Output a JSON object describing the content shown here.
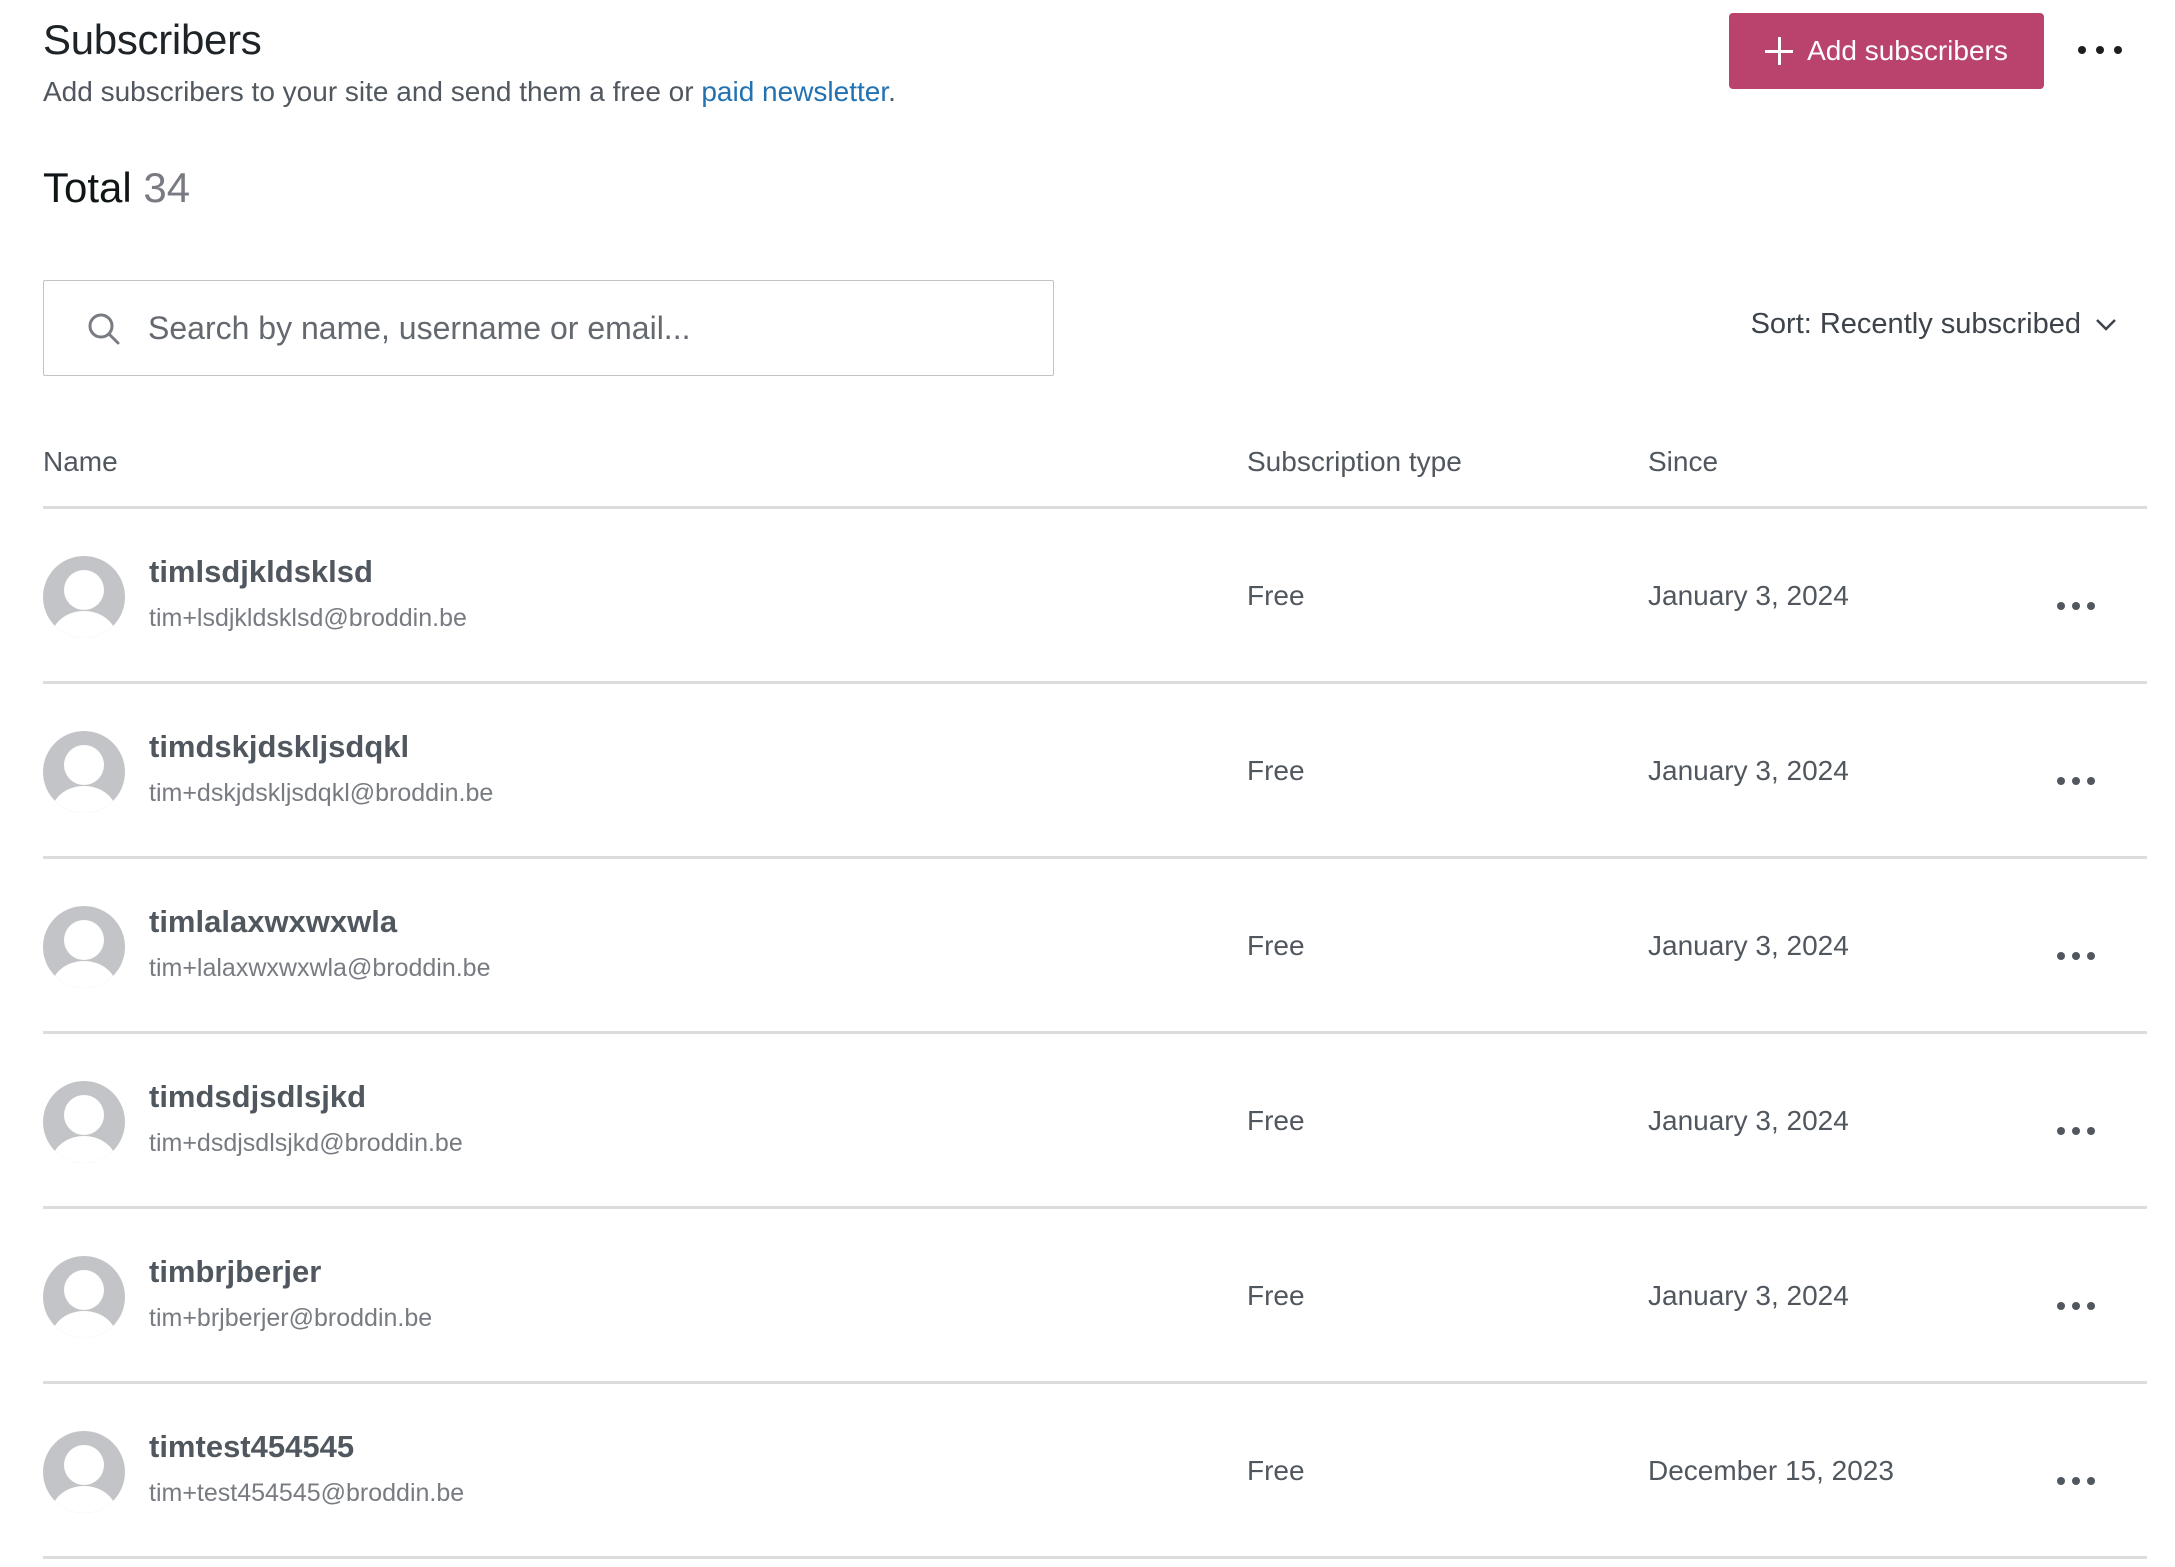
{
  "header": {
    "title": "Subscribers",
    "subtitle_prefix": "Add subscribers to your site and send them a free or ",
    "subtitle_link": "paid newsletter",
    "subtitle_suffix": ".",
    "add_button_label": "Add subscribers",
    "add_button_icon": "plus-icon",
    "more_menu_icon": "ellipsis-icon"
  },
  "total": {
    "label": "Total",
    "count": "34"
  },
  "search": {
    "placeholder": "Search by name, username or email...",
    "value": "",
    "icon": "search-icon"
  },
  "sort": {
    "label": "Sort: Recently subscribed",
    "icon": "chevron-down-icon"
  },
  "table": {
    "columns": [
      "Name",
      "Subscription type",
      "Since"
    ],
    "rows": [
      {
        "name": "timlsdjkldsklsd",
        "email": "tim+lsdjkldsklsd@broddin.be",
        "type": "Free",
        "since": "January 3, 2024"
      },
      {
        "name": "timdskjdskljsdqkl",
        "email": "tim+dskjdskljsdqkl@broddin.be",
        "type": "Free",
        "since": "January 3, 2024"
      },
      {
        "name": "timlalaxwxwxwla",
        "email": "tim+lalaxwxwxwla@broddin.be",
        "type": "Free",
        "since": "January 3, 2024"
      },
      {
        "name": "timdsdjsdlsjkd",
        "email": "tim+dsdjsdlsjkd@broddin.be",
        "type": "Free",
        "since": "January 3, 2024"
      },
      {
        "name": "timbrjberjer",
        "email": "tim+brjberjer@broddin.be",
        "type": "Free",
        "since": "January 3, 2024"
      },
      {
        "name": "timtest454545",
        "email": "tim+test454545@broddin.be",
        "type": "Free",
        "since": "December 15, 2023"
      }
    ]
  },
  "colors": {
    "accent": "#b9436d",
    "link": "#2271b1",
    "divider": "#dcdcde",
    "avatar_bg": "#c3c4c7"
  }
}
